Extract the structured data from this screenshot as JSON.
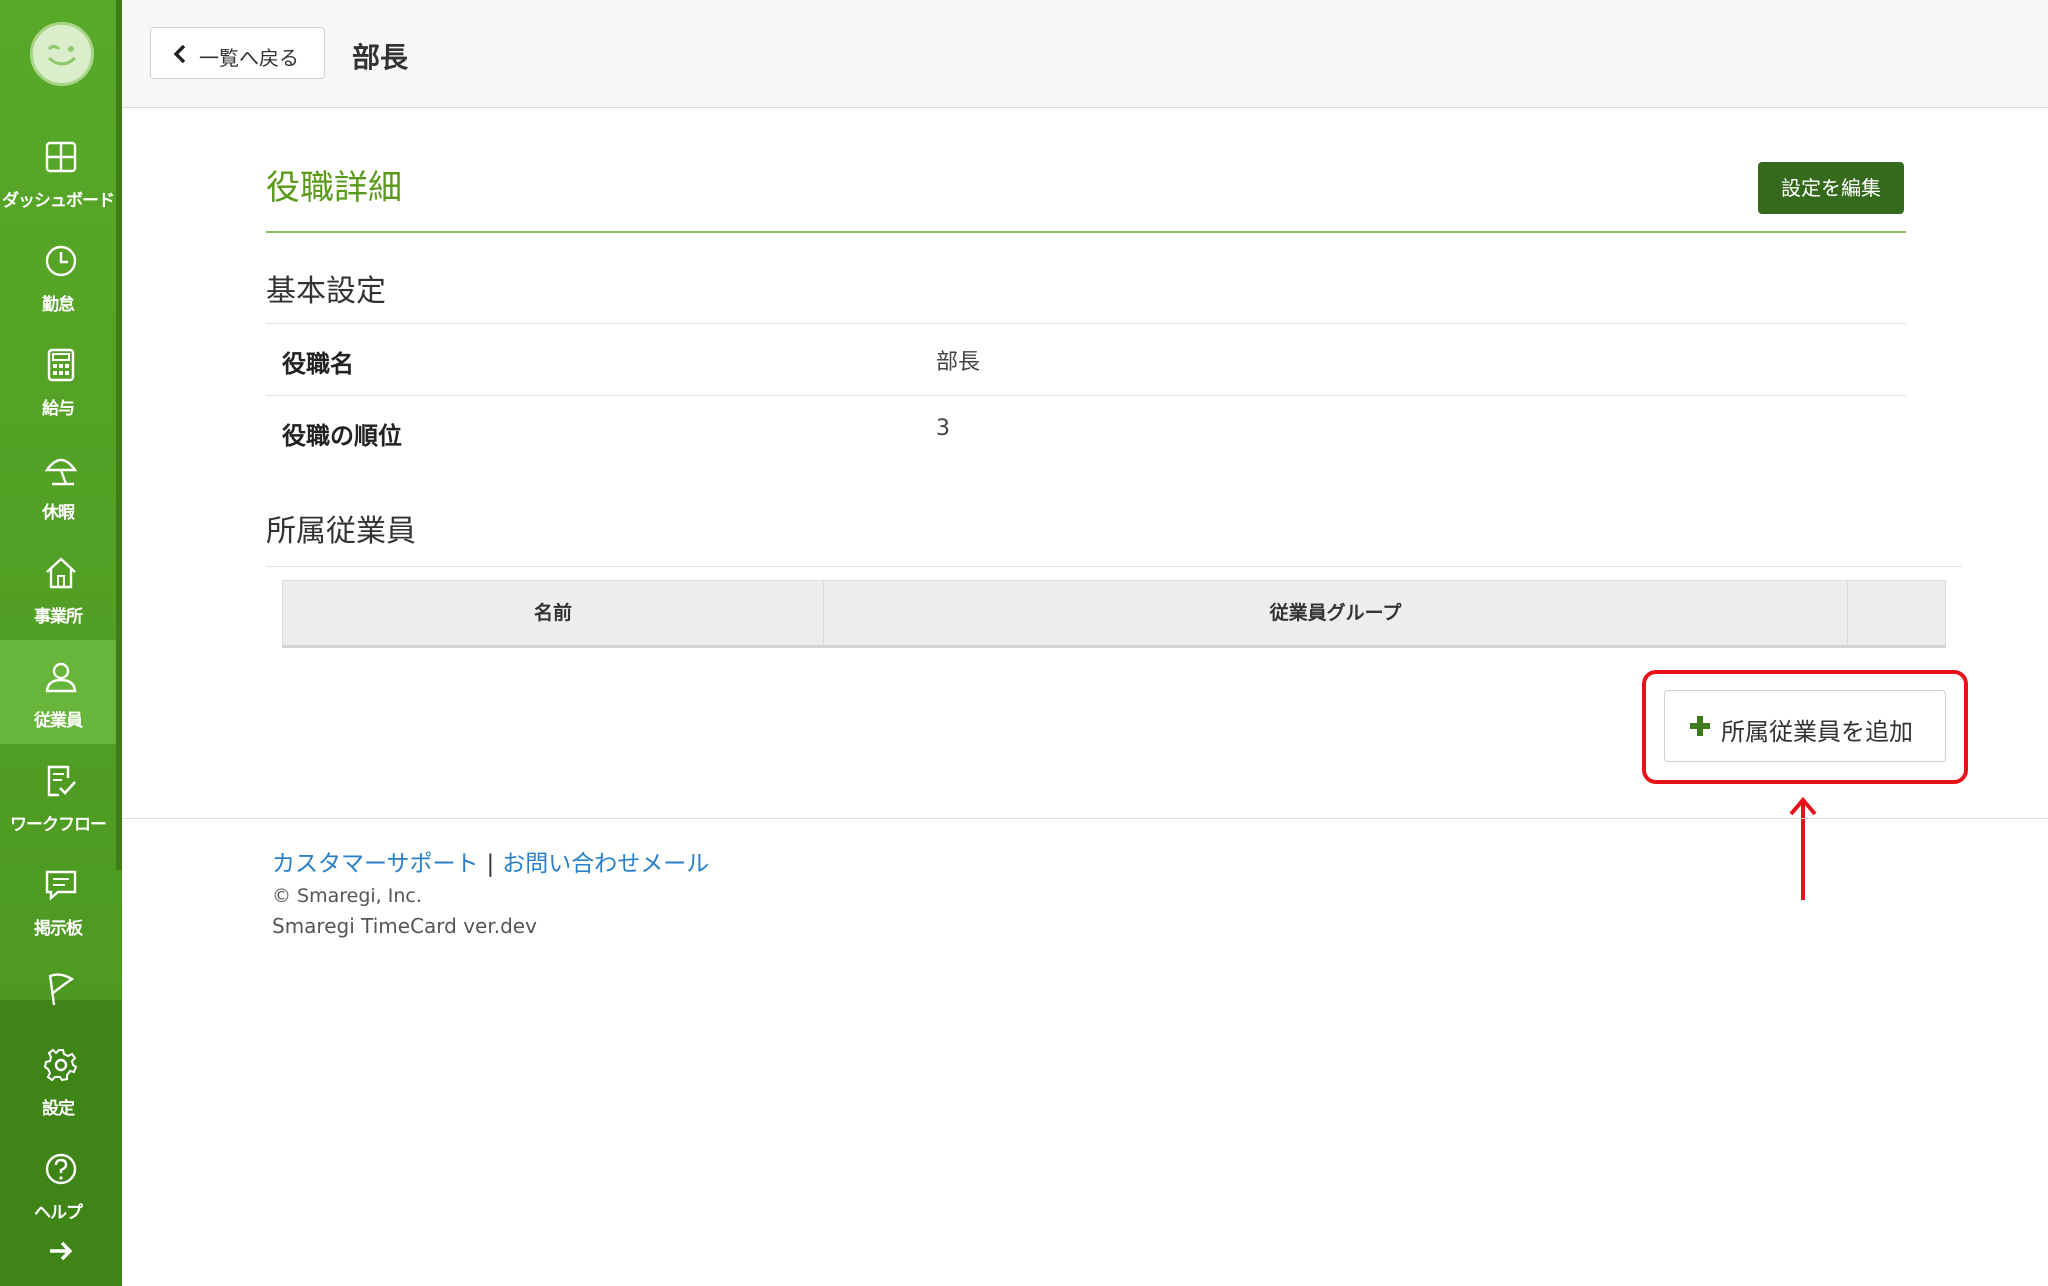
{
  "header": {
    "back_label": "一覧へ戻る",
    "title": "部長"
  },
  "sidebar": {
    "items": [
      {
        "label": "ダッシュボード",
        "icon": "dashboard-icon"
      },
      {
        "label": "勤怠",
        "icon": "clock-icon"
      },
      {
        "label": "給与",
        "icon": "calculator-icon"
      },
      {
        "label": "休暇",
        "icon": "parasol-icon"
      },
      {
        "label": "事業所",
        "icon": "home-icon"
      },
      {
        "label": "従業員",
        "icon": "person-icon",
        "active": true
      },
      {
        "label": "ワークフロー",
        "icon": "checklist-icon"
      },
      {
        "label": "掲示板",
        "icon": "message-icon"
      },
      {
        "label": "",
        "icon": "flag-icon"
      },
      {
        "label": "設定",
        "icon": "gear-icon"
      },
      {
        "label": "ヘルプ",
        "icon": "help-icon"
      }
    ],
    "expand_icon": "arrow-right-icon"
  },
  "main": {
    "section_title": "役職詳細",
    "edit_button": "設定を編集",
    "basic_heading": "基本設定",
    "fields": [
      {
        "label": "役職名",
        "value": "部長"
      },
      {
        "label": "役職の順位",
        "value": "3"
      }
    ],
    "members_heading": "所属従業員",
    "table_headers": [
      "名前",
      "従業員グループ",
      ""
    ],
    "add_button": "所属従業員を追加"
  },
  "footer": {
    "support_link": "カスタマーサポート",
    "separator": "|",
    "contact_link": "お問い合わせメール",
    "copyright": "© Smaregi, Inc.",
    "version": "Smaregi TimeCard ver.dev"
  },
  "colors": {
    "sidebar_green": "#58a829",
    "active_green": "#67b53a",
    "title_green": "#5a9a1a",
    "edit_button_bg": "#356a1d",
    "link_blue": "#2a7fc9",
    "highlight_red": "#e8121b"
  }
}
